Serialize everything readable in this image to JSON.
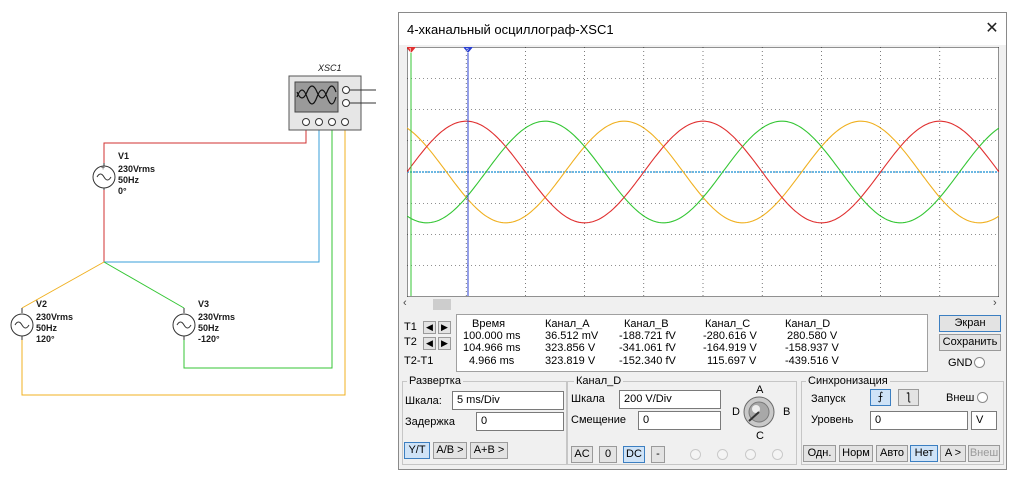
{
  "circuit": {
    "scope_label": "XSC1",
    "v1": {
      "name": "V1",
      "voltage": "230Vrms",
      "freq": "50Hz",
      "phase": "0°"
    },
    "v2": {
      "name": "V2",
      "voltage": "230Vrms",
      "freq": "50Hz",
      "phase": "120°"
    },
    "v3": {
      "name": "V3",
      "voltage": "230Vrms",
      "freq": "50Hz",
      "phase": "-120°"
    }
  },
  "window": {
    "title": "4-хканальный осциллограф-XSC1",
    "close": "✕"
  },
  "cursors": {
    "t1": "1",
    "t2": "2"
  },
  "readings": {
    "headers": [
      "Время",
      "Канал_A",
      "Канал_B",
      "Канал_C",
      "Канал_D"
    ],
    "row_labels": [
      "T1",
      "T2",
      "T2-T1"
    ],
    "rows": [
      [
        "100.000 ms",
        "36.512 mV",
        "-188.721 fV",
        "-280.616 V",
        "280.580 V"
      ],
      [
        "104.966 ms",
        "323.856 V",
        "-341.061 fV",
        "-164.919 V",
        "-158.937 V"
      ],
      [
        "4.966 ms",
        "323.819 V",
        "-152.340 fV",
        "115.697 V",
        "-439.516 V"
      ]
    ]
  },
  "side": {
    "screen": "Экран",
    "save": "Сохранить",
    "gnd": "GND"
  },
  "sweep": {
    "title": "Развертка",
    "scale_label": "Шкала:",
    "scale_value": "5 ms/Div",
    "delay_label": "Задержка",
    "delay_value": "0",
    "mode_buttons": [
      "Y/T",
      "A/B >",
      "A+B >"
    ]
  },
  "channel": {
    "title": "Канал_D",
    "scale_label": "Шкала",
    "scale_value": "200  V/Div",
    "offset_label": "Смещение",
    "offset_value": "0",
    "coupling": [
      "AC",
      "0",
      "DC",
      "-"
    ],
    "knob": {
      "a": "A",
      "b": "B",
      "c": "C",
      "d": "D"
    }
  },
  "sync": {
    "title": "Синхронизация",
    "trigger_label": "Запуск",
    "ext_label": "Внеш",
    "level_label": "Уровень",
    "level_value": "0",
    "level_unit": "V",
    "modes": [
      "Одн.",
      "Норм",
      "Авто",
      "Нет",
      "A >",
      "Внеш"
    ]
  },
  "colors": {
    "channel_a": "#e03030",
    "channel_b": "#3a9fd8",
    "channel_c": "#34c634",
    "channel_d": "#f0b020",
    "cursor_t1": "#e03030",
    "cursor_t2": "#2a3fd0",
    "screen_bg": "#ffffff",
    "grid": "#222222"
  },
  "chart_data": {
    "type": "line",
    "xlabel": "",
    "ylabel": "",
    "time_per_div_ms": 5,
    "volts_per_div": 200,
    "series": [
      {
        "channel": "A",
        "frequency_hz": 50,
        "amplitude_v": 325.3,
        "phase_deg": 0
      },
      {
        "channel": "B",
        "frequency_hz": 0,
        "amplitude_v": 0,
        "phase_deg": 0
      },
      {
        "channel": "C",
        "frequency_hz": 50,
        "amplitude_v": 325.3,
        "phase_deg": -120
      },
      {
        "channel": "D",
        "frequency_hz": 50,
        "amplitude_v": 325.3,
        "phase_deg": 120
      }
    ]
  }
}
